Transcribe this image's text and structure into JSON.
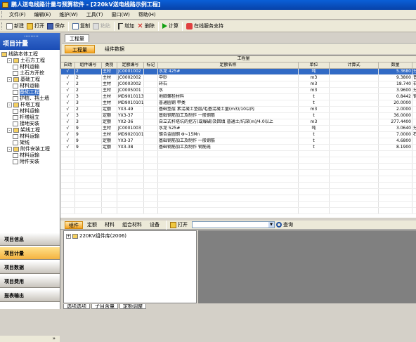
{
  "window": {
    "title": "鹏人送电线路计量与预算软件 - [220kV送电线路示例工程]"
  },
  "menu": [
    "文件(F)",
    "编辑(E)",
    "维护(W)",
    "工具(T)",
    "窗口(W)",
    "帮助(H)"
  ],
  "toolbar": [
    {
      "label": "新建",
      "icon": "new-file-icon",
      "enabled": true
    },
    {
      "label": "打开",
      "icon": "open-folder-icon",
      "enabled": true
    },
    {
      "label": "保存",
      "icon": "save-icon",
      "enabled": true
    },
    {
      "label": "复制",
      "icon": "copy-icon",
      "enabled": true
    },
    {
      "label": "粘贴",
      "icon": "paste-icon",
      "enabled": false
    },
    {
      "label": "增加",
      "icon": "add-icon",
      "enabled": true
    },
    {
      "label": "删除",
      "icon": "delete-icon",
      "enabled": true
    },
    {
      "label": "计算",
      "icon": "calculate-icon",
      "enabled": true
    },
    {
      "label": "在线服务支持",
      "icon": "online-support-icon",
      "enabled": true
    }
  ],
  "left": {
    "header": "项目计量",
    "tree": [
      {
        "label": "线路本体工程",
        "level": 0,
        "expand": ""
      },
      {
        "label": "土石方工程",
        "level": 1,
        "expand": "-"
      },
      {
        "label": "材料运输",
        "level": 2,
        "expand": ""
      },
      {
        "label": "土石方开挖",
        "level": 2,
        "expand": ""
      },
      {
        "label": "基础工程",
        "level": 1,
        "expand": "-"
      },
      {
        "label": "材料运输",
        "level": 2,
        "expand": ""
      },
      {
        "label": "基础工程",
        "level": 2,
        "expand": "",
        "selected": true
      },
      {
        "label": "护桩、挡土墙",
        "level": 2,
        "expand": ""
      },
      {
        "label": "杆塔工程",
        "level": 1,
        "expand": "-"
      },
      {
        "label": "材料运输",
        "level": 2,
        "expand": ""
      },
      {
        "label": "杆塔组立",
        "level": 2,
        "expand": ""
      },
      {
        "label": "接地安装",
        "level": 2,
        "expand": ""
      },
      {
        "label": "架线工程",
        "level": 1,
        "expand": "-"
      },
      {
        "label": "材料运输",
        "level": 2,
        "expand": ""
      },
      {
        "label": "架线",
        "level": 2,
        "expand": ""
      },
      {
        "label": "附件安装工程",
        "level": 1,
        "expand": "-"
      },
      {
        "label": "材料运输",
        "level": 2,
        "expand": ""
      },
      {
        "label": "附件安装",
        "level": 2,
        "expand": ""
      }
    ],
    "nav": [
      {
        "label": "项目信息",
        "active": false
      },
      {
        "label": "项目计量",
        "active": true
      },
      {
        "label": "项目数据",
        "active": false
      },
      {
        "label": "项目费用",
        "active": false
      },
      {
        "label": "报表输出",
        "active": false
      }
    ],
    "more": "»"
  },
  "main": {
    "top_tab": "工程量",
    "sub_tabs": [
      {
        "label": "工程量",
        "active": true
      },
      {
        "label": "组件数据",
        "active": false
      }
    ],
    "grid": {
      "group_header": "工程量",
      "columns": [
        "自动",
        "组件编号",
        "类别",
        "定额编号",
        "标记",
        "定额名称",
        "单位",
        "计算式",
        "数量",
        ""
      ],
      "rows": [
        {
          "auto": "√",
          "comp": "2",
          "cat": "主材",
          "code": "JC0001002",
          "mark": "",
          "name": "水泥 425#",
          "unit": "吨",
          "formula": "",
          "qty": "5.3680",
          "extra": "分",
          "selected": true
        },
        {
          "auto": "√",
          "comp": "2",
          "cat": "主材",
          "code": "JC0002002",
          "mark": "",
          "name": "中砂",
          "unit": "m3",
          "formula": "",
          "qty": "9.3800",
          "extra": "普"
        },
        {
          "auto": "√",
          "comp": "2",
          "cat": "主材",
          "code": "JC0003002",
          "mark": "",
          "name": "碎石",
          "unit": "m3",
          "formula": "",
          "qty": "18.740",
          "extra": "石"
        },
        {
          "auto": "√",
          "comp": "2",
          "cat": "主材",
          "code": "JC0005001",
          "mark": "",
          "name": "水",
          "unit": "m3",
          "formula": "",
          "qty": "3.9600",
          "extra": "分"
        },
        {
          "auto": "√",
          "comp": "3",
          "cat": "主材",
          "code": "MD9010113",
          "mark": "",
          "name": "地脚螺栓材料",
          "unit": "t",
          "formula": "",
          "qty": "0.8442",
          "extra": "钢"
        },
        {
          "auto": "√",
          "comp": "3",
          "cat": "主材",
          "code": "MD9010101",
          "mark": "",
          "name": "普通圆钢  甲类",
          "unit": "t",
          "formula": "",
          "qty": "20.0000",
          "extra": ""
        },
        {
          "auto": "√",
          "comp": "2",
          "cat": "定额",
          "code": "YX3-49",
          "mark": "",
          "name": "基础垫层 素混凝土垫层/毛基混凝土量(m3)/10以内",
          "unit": "m3",
          "formula": "",
          "qty": "2.0000",
          "extra": ""
        },
        {
          "auto": "√",
          "comp": "3",
          "cat": "定额",
          "code": "YX3-37",
          "mark": "",
          "name": "基础钢筋加工及制作 一般钢筋",
          "unit": "t",
          "formula": "",
          "qty": "36.0000",
          "extra": ""
        },
        {
          "auto": "√",
          "comp": "3",
          "cat": "定额",
          "code": "YX2-36",
          "mark": "",
          "name": "自立式杆塔坑的挖方(或爆破)及回填 普通土/坑深(m)/4.0以上",
          "unit": "m3",
          "formula": "",
          "qty": "277.4400",
          "extra": ""
        },
        {
          "auto": "√",
          "comp": "9",
          "cat": "主材",
          "code": "JC0001003",
          "mark": "",
          "name": "水泥 525#",
          "unit": "吨",
          "formula": "",
          "qty": "3.0640",
          "extra": "分"
        },
        {
          "auto": "√",
          "comp": "9",
          "cat": "主材",
          "code": "MD9020101",
          "mark": "",
          "name": "镀合金圆钢  Φ~15Mn",
          "unit": "t",
          "formula": "",
          "qty": "7.0000",
          "extra": "石"
        },
        {
          "auto": "√",
          "comp": "9",
          "cat": "定额",
          "code": "YX3-37",
          "mark": "",
          "name": "基础钢筋加工及制作 一般钢筋",
          "unit": "t",
          "formula": "",
          "qty": "4.6800",
          "extra": ""
        },
        {
          "auto": "√",
          "comp": "9",
          "cat": "定额",
          "code": "YX3-38",
          "mark": "",
          "name": "基础钢筋加工及制作 钢筋笼",
          "unit": "t",
          "formula": "",
          "qty": "8.1900",
          "extra": ""
        }
      ]
    },
    "bottom": {
      "tabs": [
        {
          "label": "组件",
          "active": true
        },
        {
          "label": "定额",
          "active": false
        },
        {
          "label": "材料",
          "active": false
        },
        {
          "label": "组合材料",
          "active": false
        },
        {
          "label": "设备",
          "active": false
        }
      ],
      "open_label": "打开",
      "query_label": "查询",
      "tree_item": "220KV组件库(2006)",
      "footer_tabs": [
        "选项选项",
        "子目含量",
        "定额调整"
      ]
    }
  }
}
